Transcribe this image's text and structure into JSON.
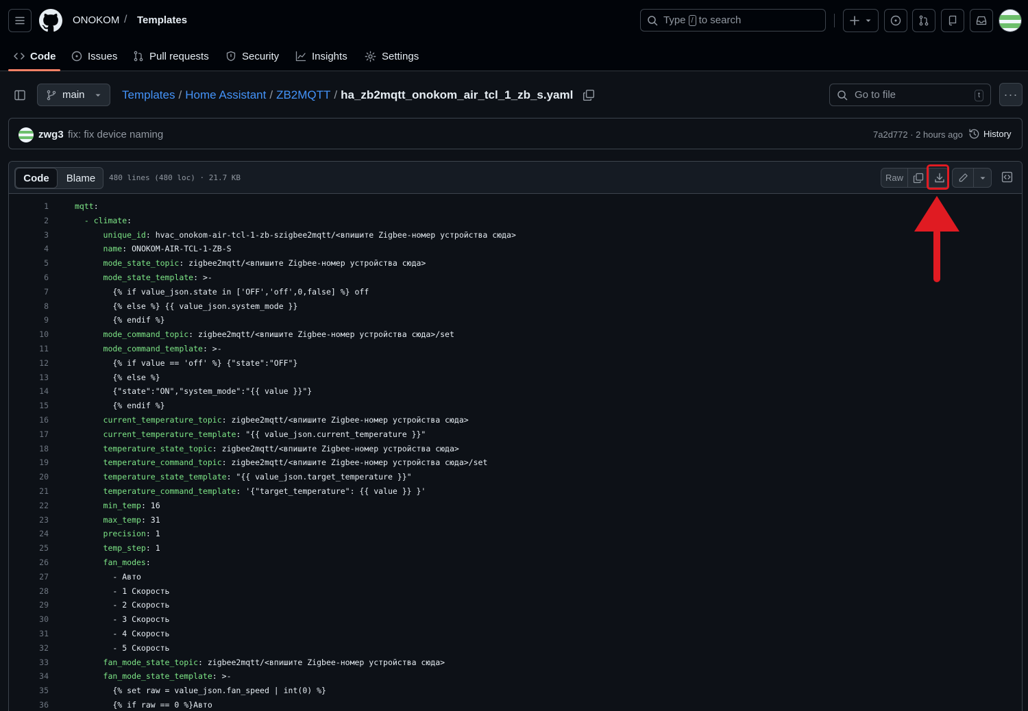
{
  "header": {
    "owner": "ONOKOM",
    "slash": "/",
    "repo": "Templates",
    "search_text_1": "Type",
    "search_kbd": "/",
    "search_text_2": "to search",
    "plus": "+"
  },
  "tabs": [
    {
      "label": "Code"
    },
    {
      "label": "Issues"
    },
    {
      "label": "Pull requests"
    },
    {
      "label": "Security"
    },
    {
      "label": "Insights"
    },
    {
      "label": "Settings"
    }
  ],
  "branch": "main",
  "path": {
    "p1": "Templates",
    "p2": "Home Assistant",
    "p3": "ZB2MQTT",
    "file": "ha_zb2mqtt_onokom_air_tcl_1_zb_s.yaml",
    "sep": "/"
  },
  "gotofile": {
    "placeholder": "Go to file",
    "kbd": "t"
  },
  "more": "···",
  "commit": {
    "author": "zwg3",
    "message": "fix: fix device naming",
    "meta": "7a2d772 · 2 hours ago",
    "history": "History"
  },
  "file": {
    "tab_code": "Code",
    "tab_blame": "Blame",
    "info": "480 lines (480 loc) · 21.7 KB",
    "raw": "Raw"
  },
  "code_lines": [
    {
      "n": "1",
      "k": "mqtt",
      "r": ":"
    },
    {
      "n": "2",
      "k": "  - climate",
      "r": ":"
    },
    {
      "n": "3",
      "k": "      unique_id",
      "r": ": hvac_onokom-air-tcl-1-zb-szigbee2mqtt/<впишите Zigbee-номер устройства сюда>"
    },
    {
      "n": "4",
      "k": "      name",
      "r": ": ONOKOM-AIR-TCL-1-ZB-S"
    },
    {
      "n": "5",
      "k": "      mode_state_topic",
      "r": ": zigbee2mqtt/<впишите Zigbee-номер устройства сюда>"
    },
    {
      "n": "6",
      "k": "      mode_state_template",
      "r": ": >-"
    },
    {
      "n": "7",
      "k": "",
      "r": "        {% if value_json.state in ['OFF','off',0,false] %} off"
    },
    {
      "n": "8",
      "k": "",
      "r": "        {% else %} {{ value_json.system_mode }}"
    },
    {
      "n": "9",
      "k": "",
      "r": "        {% endif %}"
    },
    {
      "n": "10",
      "k": "      mode_command_topic",
      "r": ": zigbee2mqtt/<впишите Zigbee-номер устройства сюда>/set"
    },
    {
      "n": "11",
      "k": "      mode_command_template",
      "r": ": >-"
    },
    {
      "n": "12",
      "k": "",
      "r": "        {% if value == 'off' %} {\"state\":\"OFF\"}"
    },
    {
      "n": "13",
      "k": "",
      "r": "        {% else %}"
    },
    {
      "n": "14",
      "k": "",
      "r": "        {\"state\":\"ON\",\"system_mode\":\"{{ value }}\"}"
    },
    {
      "n": "15",
      "k": "",
      "r": "        {% endif %}"
    },
    {
      "n": "16",
      "k": "      current_temperature_topic",
      "r": ": zigbee2mqtt/<впишите Zigbee-номер устройства сюда>"
    },
    {
      "n": "17",
      "k": "      current_temperature_template",
      "r": ": \"{{ value_json.current_temperature }}\""
    },
    {
      "n": "18",
      "k": "      temperature_state_topic",
      "r": ": zigbee2mqtt/<впишите Zigbee-номер устройства сюда>"
    },
    {
      "n": "19",
      "k": "      temperature_command_topic",
      "r": ": zigbee2mqtt/<впишите Zigbee-номер устройства сюда>/set"
    },
    {
      "n": "20",
      "k": "      temperature_state_template",
      "r": ": \"{{ value_json.target_temperature }}\""
    },
    {
      "n": "21",
      "k": "      temperature_command_template",
      "r": ": '{\"target_temperature\": {{ value }} }'"
    },
    {
      "n": "22",
      "k": "      min_temp",
      "r": ": 16"
    },
    {
      "n": "23",
      "k": "      max_temp",
      "r": ": 31"
    },
    {
      "n": "24",
      "k": "      precision",
      "r": ": 1"
    },
    {
      "n": "25",
      "k": "      temp_step",
      "r": ": 1"
    },
    {
      "n": "26",
      "k": "      fan_modes",
      "r": ":"
    },
    {
      "n": "27",
      "k": "",
      "r": "        - Авто"
    },
    {
      "n": "28",
      "k": "",
      "r": "        - 1 Скорость"
    },
    {
      "n": "29",
      "k": "",
      "r": "        - 2 Скорость"
    },
    {
      "n": "30",
      "k": "",
      "r": "        - 3 Скорость"
    },
    {
      "n": "31",
      "k": "",
      "r": "        - 4 Скорость"
    },
    {
      "n": "32",
      "k": "",
      "r": "        - 5 Скорость"
    },
    {
      "n": "33",
      "k": "      fan_mode_state_topic",
      "r": ": zigbee2mqtt/<впишите Zigbee-номер устройства сюда>"
    },
    {
      "n": "34",
      "k": "      fan_mode_state_template",
      "r": ": >-"
    },
    {
      "n": "35",
      "k": "",
      "r": "        {% set raw = value_json.fan_speed | int(0) %}"
    },
    {
      "n": "36",
      "k": "",
      "r": "        {% if raw == 0 %}Авто"
    }
  ],
  "colors": {
    "accent": "#4493f8",
    "tab_underline": "#f78166",
    "yaml_key": "#7ee787",
    "highlight": "#e01b22"
  }
}
